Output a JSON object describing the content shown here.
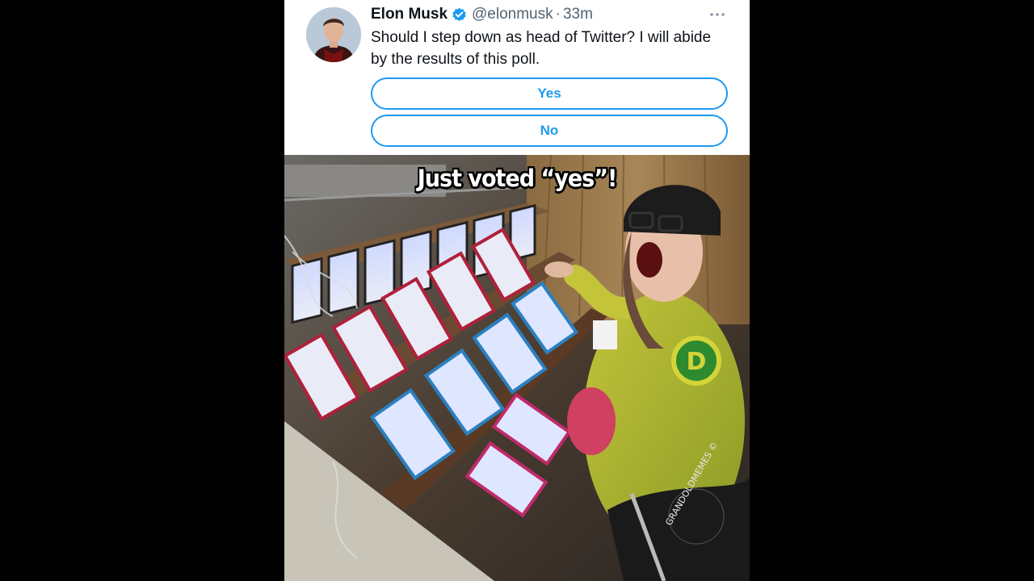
{
  "tweet": {
    "display_name": "Elon Musk",
    "handle": "@elonmusk",
    "separator": "·",
    "time": "33m",
    "text": "Should I step down as head of Twitter? I will abide by the results of this poll.",
    "poll_options": [
      {
        "label": "Yes"
      },
      {
        "label": "No"
      }
    ],
    "icons": [
      "verified-badge-icon",
      "more-options-icon"
    ],
    "colors": {
      "accent": "#1d9bf0",
      "text": "#0f1419",
      "secondary": "#536471"
    }
  },
  "meme": {
    "caption": "Just voted “yes”!",
    "watermark": "GRANDOLDMEMES ©",
    "badge_letter": "D"
  }
}
